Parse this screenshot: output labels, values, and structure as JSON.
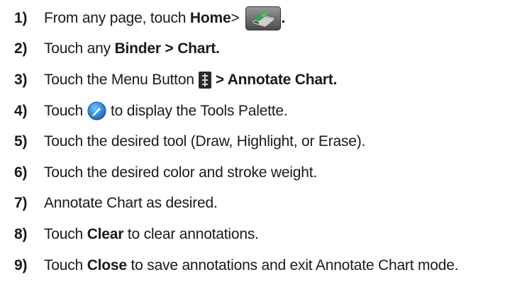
{
  "steps": [
    {
      "num": "1)",
      "t1": "From any page, touch ",
      "b1": "Home",
      "t2": " > ",
      "icon": "home-binder-icon",
      "b2": "."
    },
    {
      "num": "2)",
      "t1": "Touch any ",
      "b1": "Binder > Chart."
    },
    {
      "num": "3)",
      "t1": "Touch the Menu Button ",
      "icon": "menu-button-icon",
      "b1": " > Annotate Chart."
    },
    {
      "num": "4)",
      "t1": "Touch ",
      "icon": "annotate-pencil-icon",
      "t2": " to display the Tools Palette."
    },
    {
      "num": "5)",
      "t1": "Touch the desired tool (Draw, Highlight, or Erase)."
    },
    {
      "num": "6)",
      "t1": "Touch the desired color and stroke weight."
    },
    {
      "num": "7)",
      "t1": "Annotate Chart as desired."
    },
    {
      "num": "8)",
      "t1": "Touch ",
      "b1": "Clear",
      "t2": " to clear annotations."
    },
    {
      "num": "9)",
      "t1": "Touch ",
      "b1": "Close",
      "t2": " to save annotations and exit Annotate Chart mode."
    }
  ]
}
